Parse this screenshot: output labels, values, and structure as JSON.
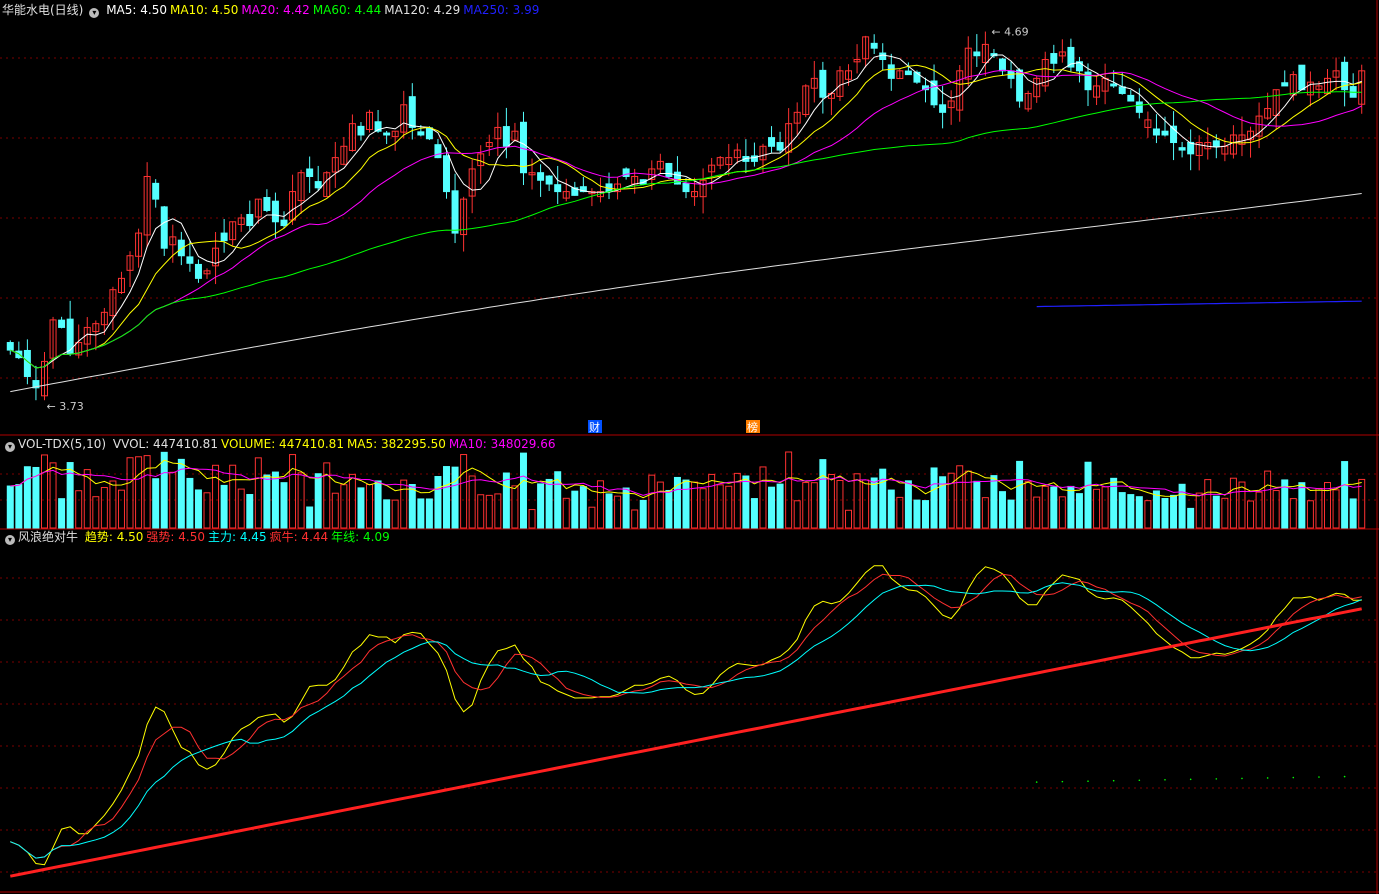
{
  "header": {
    "price": {
      "name": "华能水电(日线)",
      "items": [
        {
          "label": "MA5: 4.50",
          "color": "#ffffff"
        },
        {
          "label": "MA10: 4.50",
          "color": "#ffff00"
        },
        {
          "label": "MA20: 4.42",
          "color": "#ff00ff"
        },
        {
          "label": "MA60: 4.44",
          "color": "#00ff00"
        },
        {
          "label": "MA120: 4.29",
          "color": "#e0e0e0"
        },
        {
          "label": "MA250: 3.99",
          "color": "#2020ff"
        }
      ]
    },
    "volume": {
      "name": "VOL-TDX(5,10)",
      "items": [
        {
          "label": "VVOL: 447410.81",
          "color": "#e0e0e0"
        },
        {
          "label": "VOLUME: 447410.81",
          "color": "#ffff00"
        },
        {
          "label": "MA5: 382295.50",
          "color": "#ffff00"
        },
        {
          "label": "MA10: 348029.66",
          "color": "#ff00ff"
        }
      ]
    },
    "indicator": {
      "name": "风浪绝对牛",
      "items": [
        {
          "label": "趋势: 4.50",
          "color": "#ffff00"
        },
        {
          "label": "强势: 4.50",
          "color": "#ff3030"
        },
        {
          "label": "主力: 4.45",
          "color": "#00ffff"
        },
        {
          "label": "疯牛: 4.44",
          "color": "#ff3030"
        },
        {
          "label": "年线: 4.09",
          "color": "#00ff00"
        }
      ]
    }
  },
  "annotations": {
    "high_label": "4.69",
    "low_label": "3.73",
    "marker1": "财",
    "marker2": "榜"
  },
  "colors": {
    "up": "#ff3232",
    "down": "#54ffff",
    "grid": "#7a0000",
    "frame": "#b00000"
  },
  "chart_data": {
    "type": "candlestick",
    "closes": [
      3.86,
      3.84,
      3.79,
      3.76,
      3.83,
      3.94,
      3.92,
      3.85,
      3.88,
      3.92,
      3.93,
      3.96,
      4.02,
      4.05,
      4.11,
      4.17,
      4.32,
      4.26,
      4.13,
      4.16,
      4.11,
      4.09,
      4.05,
      4.07,
      4.13,
      4.15,
      4.2,
      4.21,
      4.19,
      4.26,
      4.23,
      4.2,
      4.19,
      4.28,
      4.33,
      4.32,
      4.29,
      4.33,
      4.37,
      4.4,
      4.46,
      4.43,
      4.49,
      4.44,
      4.43,
      4.44,
      4.51,
      4.45,
      4.43,
      4.42,
      4.37,
      4.28,
      4.17,
      4.26,
      4.34,
      4.38,
      4.41,
      4.45,
      4.4,
      4.44,
      4.33,
      4.33,
      4.31,
      4.3,
      4.28,
      4.28,
      4.27,
      4.28,
      4.28,
      4.28,
      4.28,
      4.3,
      4.32,
      4.32,
      4.3,
      4.34,
      4.36,
      4.32,
      4.3,
      4.28,
      4.28,
      4.31,
      4.35,
      4.37,
      4.37,
      4.39,
      4.36,
      4.36,
      4.4,
      4.4,
      4.39,
      4.46,
      4.49,
      4.56,
      4.58,
      4.53,
      4.54,
      4.6,
      4.6,
      4.63,
      4.69,
      4.66,
      4.63,
      4.58,
      4.6,
      4.59,
      4.57,
      4.55,
      4.51,
      4.49,
      4.52,
      4.6,
      4.66,
      4.64,
      4.67,
      4.64,
      4.6,
      4.58,
      4.52,
      4.54,
      4.58,
      4.63,
      4.62,
      4.65,
      4.61,
      4.6,
      4.55,
      4.56,
      4.58,
      4.56,
      4.54,
      4.52,
      4.49,
      4.47,
      4.43,
      4.43,
      4.41,
      4.39,
      4.38,
      4.41,
      4.41,
      4.4,
      4.4,
      4.43,
      4.43,
      4.44,
      4.48,
      4.5,
      4.55,
      4.56,
      4.59,
      4.55,
      4.57,
      4.56,
      4.58,
      4.6,
      4.55,
      4.53,
      4.6
    ],
    "volume_ma5": 382295.5,
    "volume_ma10": 348029.66
  }
}
